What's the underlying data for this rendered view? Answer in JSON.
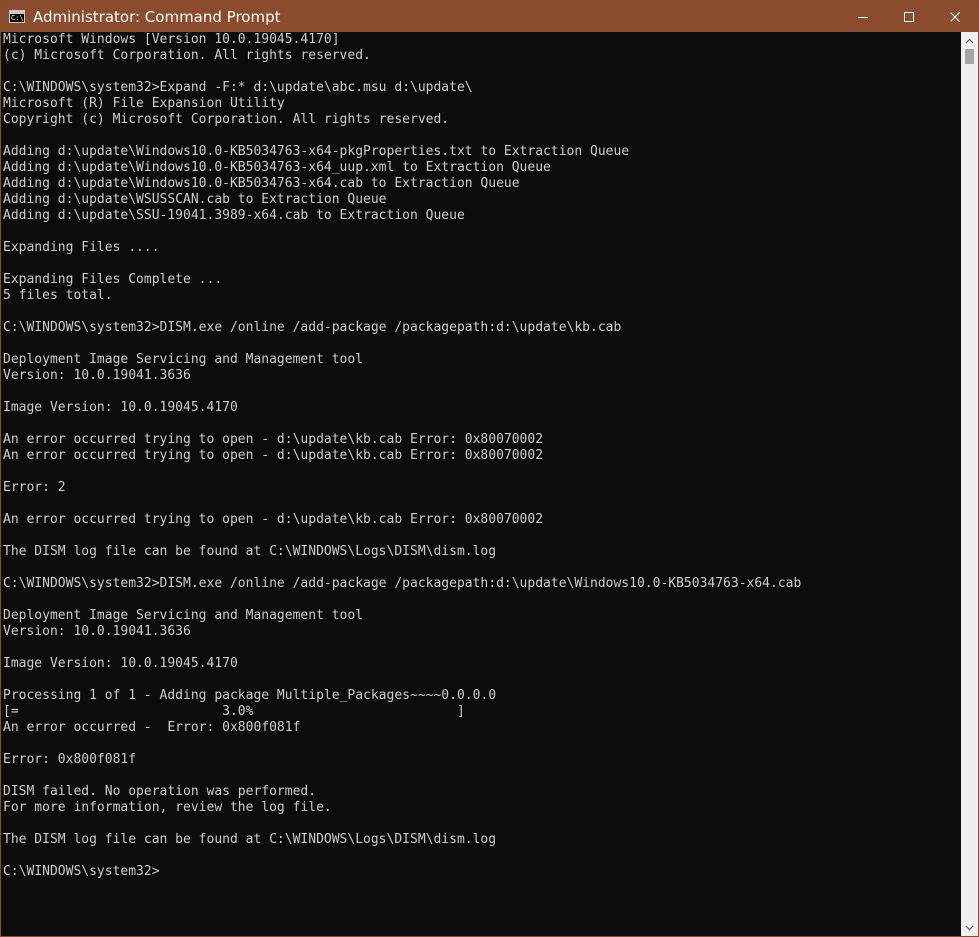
{
  "window": {
    "title": "Administrator: Command Prompt",
    "icon": "cmd-icon",
    "icon_text": "C:\\_",
    "controls": [
      "minimize-icon",
      "maximize-icon",
      "close-icon"
    ]
  },
  "console": {
    "lines": [
      "Microsoft Windows [Version 10.0.19045.4170]",
      "(c) Microsoft Corporation. All rights reserved.",
      "",
      "C:\\WINDOWS\\system32>Expand -F:* d:\\update\\abc.msu d:\\update\\",
      "Microsoft (R) File Expansion Utility",
      "Copyright (c) Microsoft Corporation. All rights reserved.",
      "",
      "Adding d:\\update\\Windows10.0-KB5034763-x64-pkgProperties.txt to Extraction Queue",
      "Adding d:\\update\\Windows10.0-KB5034763-x64_uup.xml to Extraction Queue",
      "Adding d:\\update\\Windows10.0-KB5034763-x64.cab to Extraction Queue",
      "Adding d:\\update\\WSUSSCAN.cab to Extraction Queue",
      "Adding d:\\update\\SSU-19041.3989-x64.cab to Extraction Queue",
      "",
      "Expanding Files ....",
      "",
      "Expanding Files Complete ...",
      "5 files total.",
      "",
      "C:\\WINDOWS\\system32>DISM.exe /online /add-package /packagepath:d:\\update\\kb.cab",
      "",
      "Deployment Image Servicing and Management tool",
      "Version: 10.0.19041.3636",
      "",
      "Image Version: 10.0.19045.4170",
      "",
      "An error occurred trying to open - d:\\update\\kb.cab Error: 0x80070002",
      "An error occurred trying to open - d:\\update\\kb.cab Error: 0x80070002",
      "",
      "Error: 2",
      "",
      "An error occurred trying to open - d:\\update\\kb.cab Error: 0x80070002",
      "",
      "The DISM log file can be found at C:\\WINDOWS\\Logs\\DISM\\dism.log",
      "",
      "C:\\WINDOWS\\system32>DISM.exe /online /add-package /packagepath:d:\\update\\Windows10.0-KB5034763-x64.cab",
      "",
      "Deployment Image Servicing and Management tool",
      "Version: 10.0.19041.3636",
      "",
      "Image Version: 10.0.19045.4170",
      "",
      "Processing 1 of 1 - Adding package Multiple_Packages~~~~0.0.0.0",
      "[=                          3.0%                          ]",
      "An error occurred -  Error: 0x800f081f",
      "",
      "Error: 0x800f081f",
      "",
      "DISM failed. No operation was performed.",
      "For more information, review the log file.",
      "",
      "The DISM log file can be found at C:\\WINDOWS\\Logs\\DISM\\dism.log",
      "",
      "C:\\WINDOWS\\system32>"
    ]
  },
  "scrollbar": {
    "up_icon": "chevron-up-icon",
    "down_icon": "chevron-down-icon"
  },
  "colors": {
    "titlebar": "#8b4b2d",
    "console_bg": "#0c0c0c",
    "console_fg": "#cccccc",
    "scrollbar_bg": "#f0f0f0",
    "scroll_thumb": "#a6a6a6"
  }
}
